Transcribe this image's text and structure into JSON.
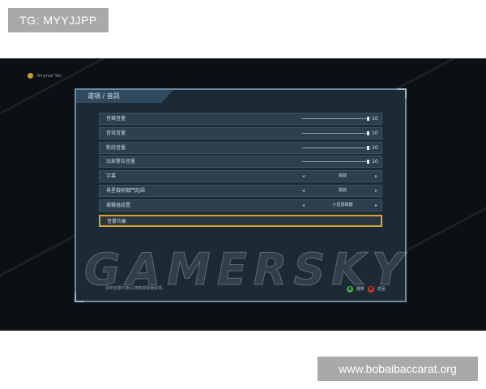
{
  "tg_badge": "TG: MYYJJPP",
  "site_badge": "www.bobaibaccarat.org",
  "player_name": "Amyrsal Tan",
  "panel_title": "選項 / 音訊",
  "watermark": "GAMERSKY",
  "sliders": [
    {
      "label": "音樂音量",
      "value": "10",
      "level": 1.0
    },
    {
      "label": "音效音量",
      "value": "10",
      "level": 1.0
    },
    {
      "label": "對話音量",
      "value": "10",
      "level": 1.0
    },
    {
      "label": "玩家警告音量",
      "value": "10",
      "level": 1.0
    }
  ],
  "options": [
    {
      "label": "字幕",
      "value": "開啟"
    },
    {
      "label": "尋星戰術戰鬥話語",
      "value": "開啟"
    },
    {
      "label": "揚聲器設置",
      "value": "小型揚聲器"
    }
  ],
  "selected_row": {
    "label": "音響均衡"
  },
  "hint": "調節音響均衡以適應揚聲器效果。",
  "buttons": {
    "select": {
      "glyph": "A",
      "label": "選擇",
      "color": "#3fae49"
    },
    "back": {
      "glyph": "B",
      "label": "返回",
      "color": "#d2342c"
    }
  },
  "colors": {
    "highlight": "#d4a62a",
    "panel_border": "#6b8aa0"
  }
}
